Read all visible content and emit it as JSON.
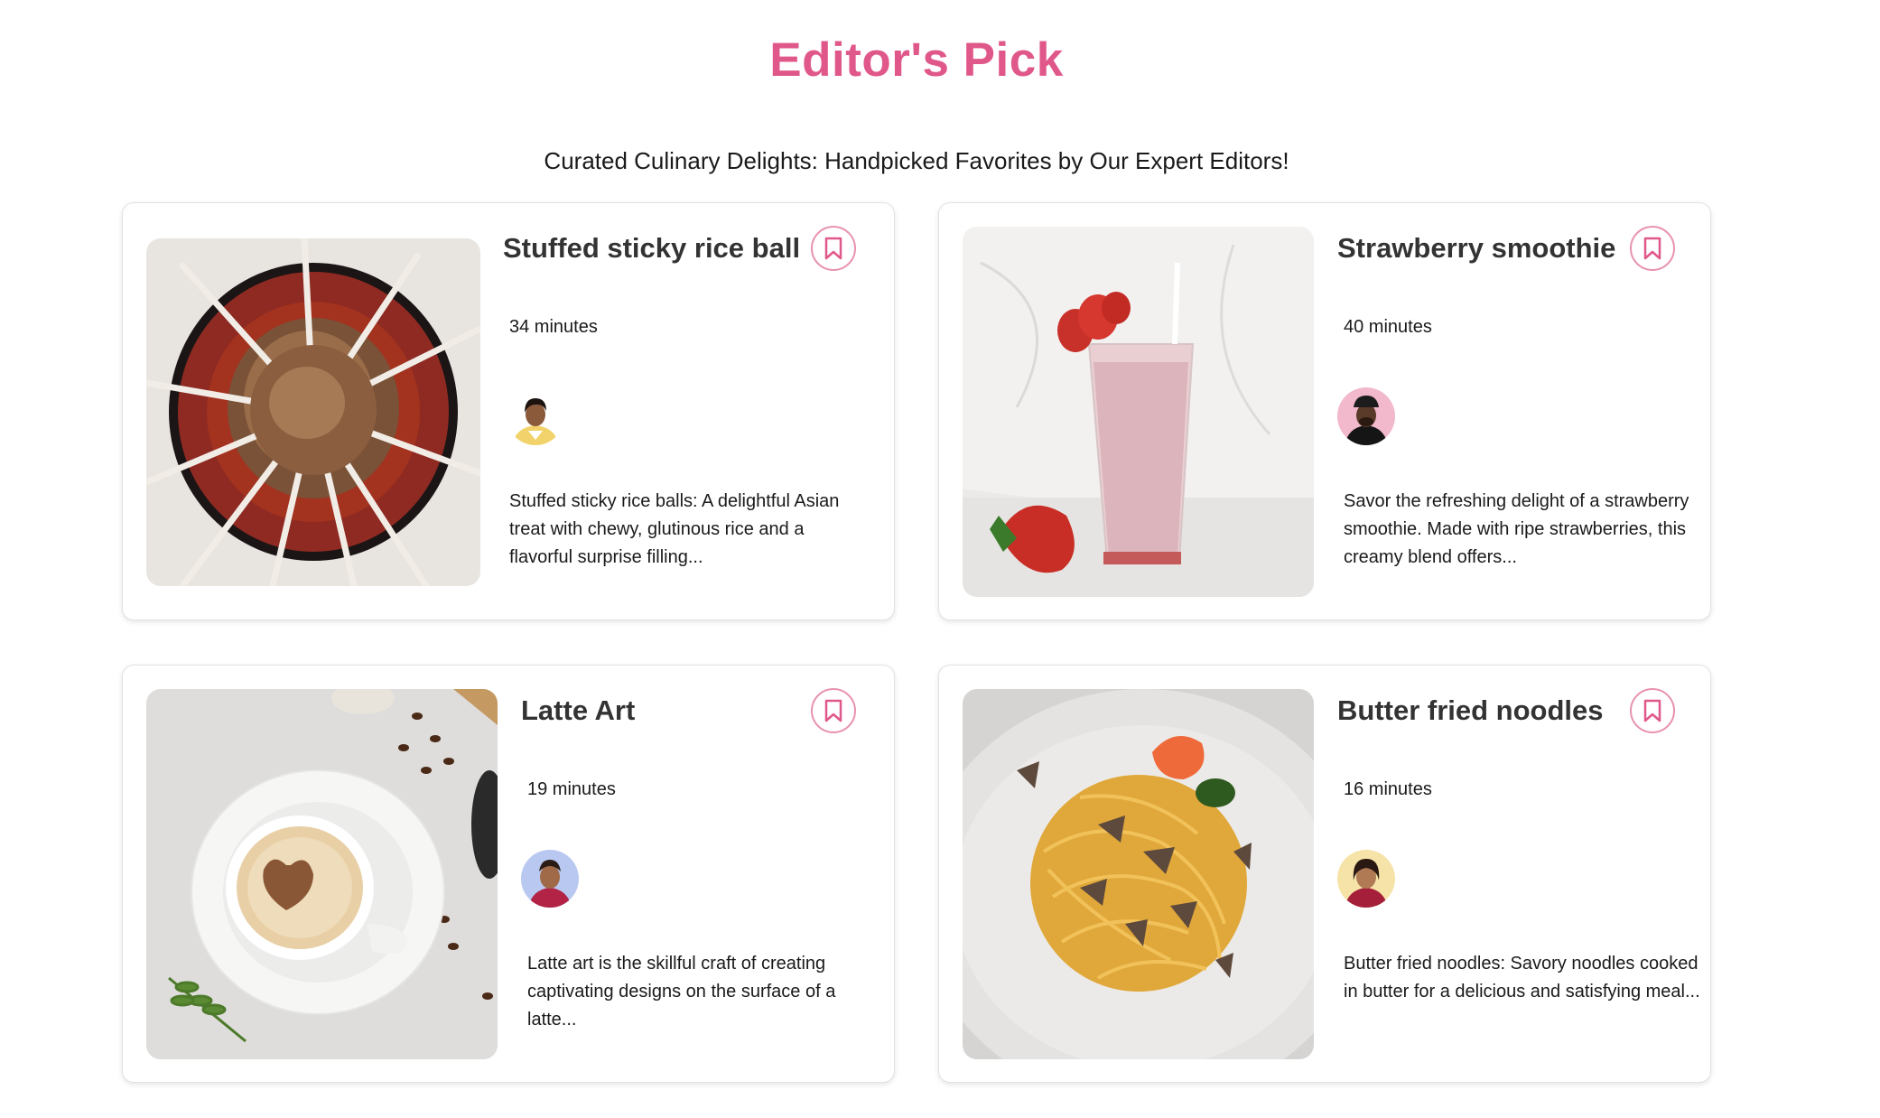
{
  "header": {
    "title": "Editor's Pick",
    "subtitle": "Curated Culinary Delights: Handpicked Favorites by Our Expert Editors!"
  },
  "colors": {
    "accent": "#e0588a",
    "bookmark_border": "#e892ad"
  },
  "recipes": [
    {
      "title": "Stuffed sticky rice ball",
      "minutes": "34 minutes",
      "description": "Stuffed sticky rice balls: A delightful Asian treat with chewy, glutinous rice and a flavorful surprise filling...",
      "bookmark_icon": "bookmark-icon"
    },
    {
      "title": "Strawberry smoothie",
      "minutes": "40 minutes",
      "description": "Savor the refreshing delight of a strawberry smoothie. Made with ripe strawberries, this creamy blend offers...",
      "bookmark_icon": "bookmark-icon"
    },
    {
      "title": "Latte Art",
      "minutes": "19 minutes",
      "description": "Latte art is the skillful craft of creating captivating designs on the surface of a latte...",
      "bookmark_icon": "bookmark-icon"
    },
    {
      "title": "Butter fried noodles",
      "minutes": "16 minutes",
      "description": "Butter fried noodles: Savory noodles cooked in butter for a delicious and satisfying meal...",
      "bookmark_icon": "bookmark-icon"
    }
  ]
}
